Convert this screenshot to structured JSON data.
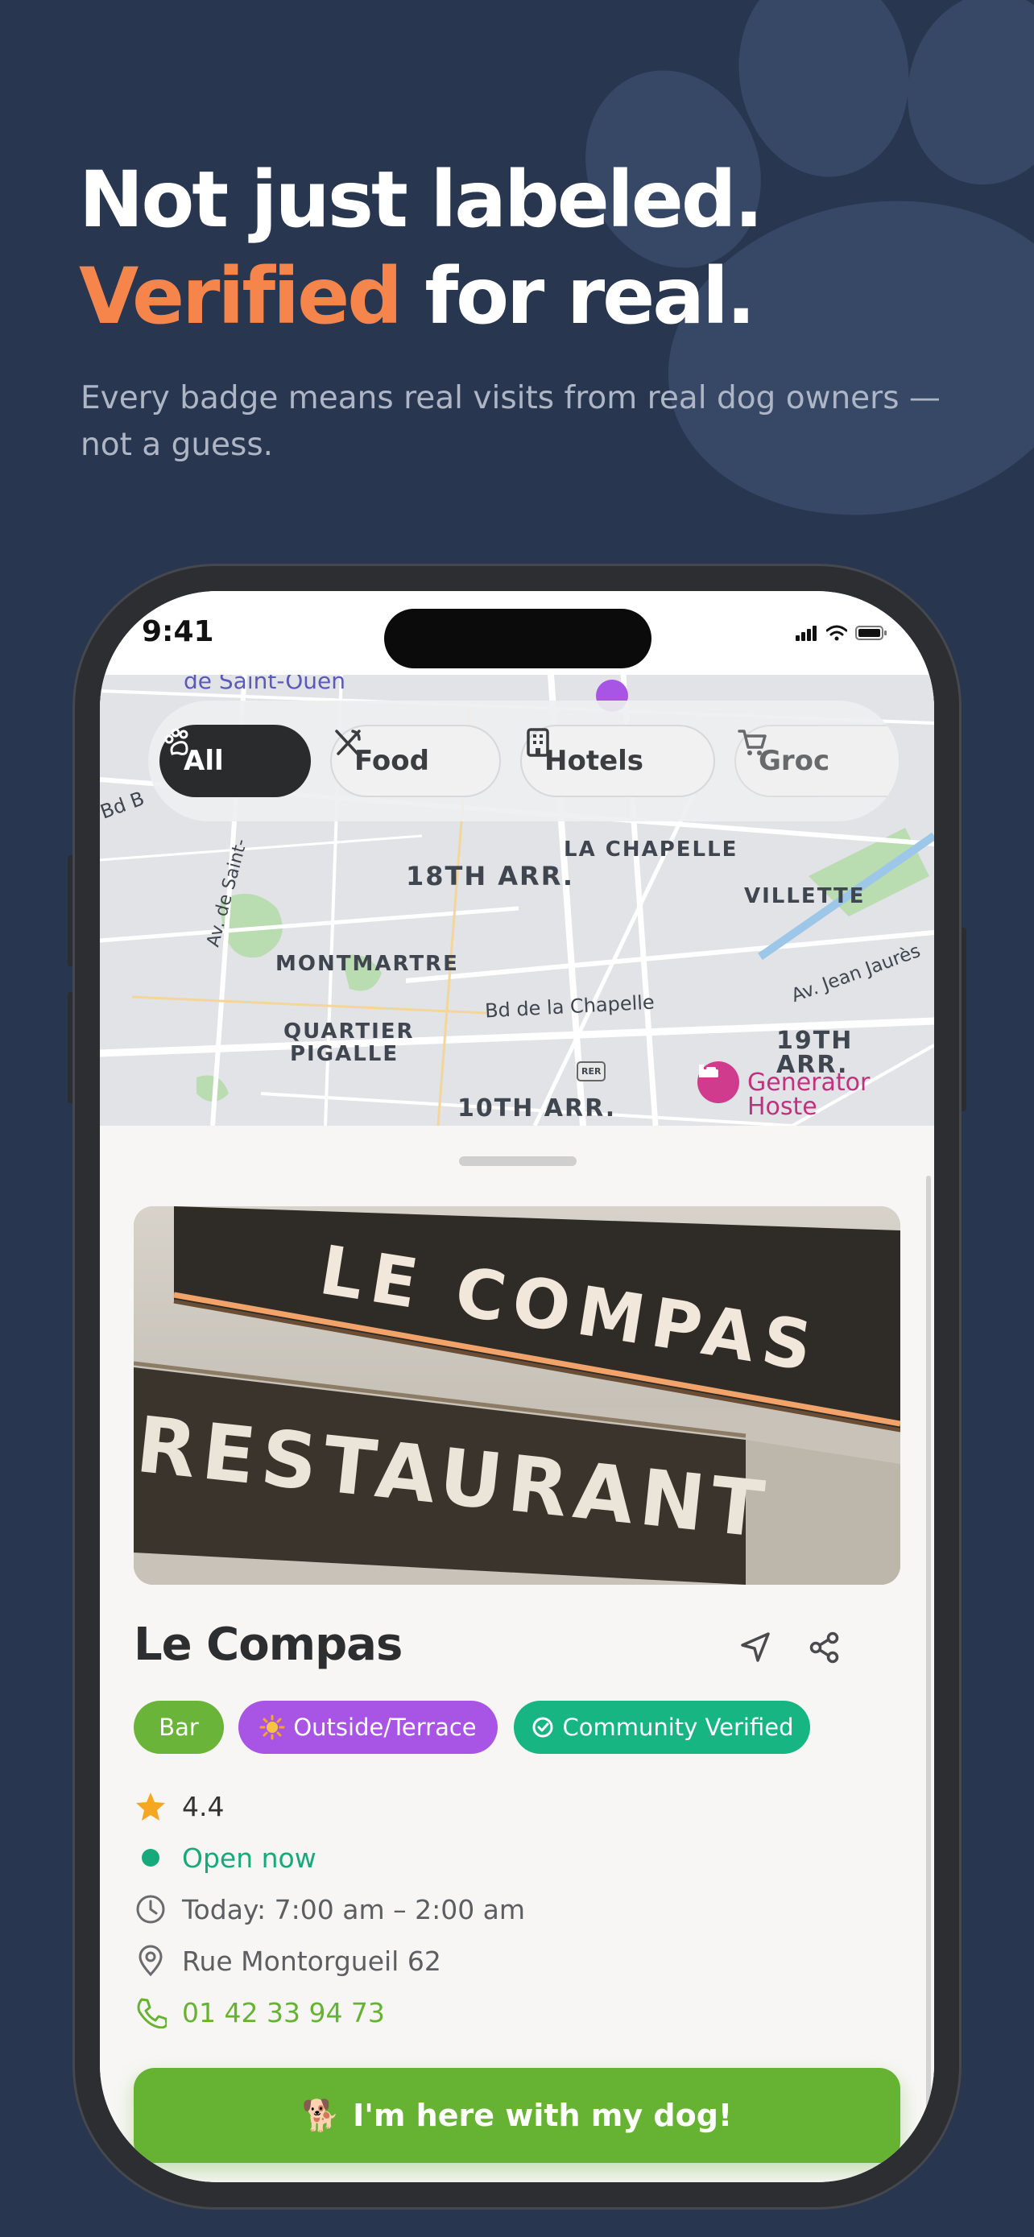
{
  "headline": {
    "line1": "Not just labeled.",
    "accent": "Verified",
    "line2_rest": " for real."
  },
  "subtitle": "Every badge means real visits from real dog owners — not a guess.",
  "phone": {
    "status_time": "9:41"
  },
  "filters": [
    {
      "label": "All",
      "icon": "paw-icon",
      "active": true
    },
    {
      "label": "Food",
      "icon": "utensils-icon",
      "active": false
    },
    {
      "label": "Hotels",
      "icon": "building-icon",
      "active": false
    },
    {
      "label": "Groc",
      "icon": "cart-icon",
      "active": false
    }
  ],
  "map": {
    "labels": {
      "top_street": "de Saint-Ouen",
      "bd_left": "Bd B",
      "av_saint": "Av. de Saint-",
      "arr18": "18TH ARR.",
      "la_chapelle": "LA CHAPELLE",
      "villette": "VILLETTE",
      "montmartre": "MONTMARTRE",
      "quartier": "QUARTIER",
      "pigalle": "PIGALLE",
      "bd_chapelle": "Bd de la Chapelle",
      "av_jaures": "Av. Jean Jaurès",
      "arr19": "19TH ARR.",
      "arr10": "10TH ARR.",
      "rer": "RER",
      "generator": "Generator Hoste"
    }
  },
  "place": {
    "photo_sign_top": "LE COMPAS",
    "photo_sign_bottom": "RESTAURANT",
    "name": "Le Compas",
    "badges": [
      {
        "label": "Bar",
        "color": "#6ab43a",
        "icon": ""
      },
      {
        "label": "Outside/Terrace",
        "color": "#a855e6",
        "icon": "sun-icon"
      },
      {
        "label": "Community Verified",
        "color": "#17b582",
        "icon": "check-circle-icon"
      }
    ],
    "rating": "4.4",
    "open_status": "Open now",
    "hours": "Today: 7:00 am – 2:00 am",
    "address": "Rue Montorgueil 62",
    "phone": "01 42 33 94 73",
    "cta": "I'm here with my dog!",
    "cta_emoji": "🐕"
  },
  "colors": {
    "background": "#283650",
    "accent_orange": "#f5854a",
    "brand_green": "#66b232",
    "open_green": "#17a97c",
    "verified_green": "#17b582",
    "terrace_purple": "#a855e6"
  }
}
